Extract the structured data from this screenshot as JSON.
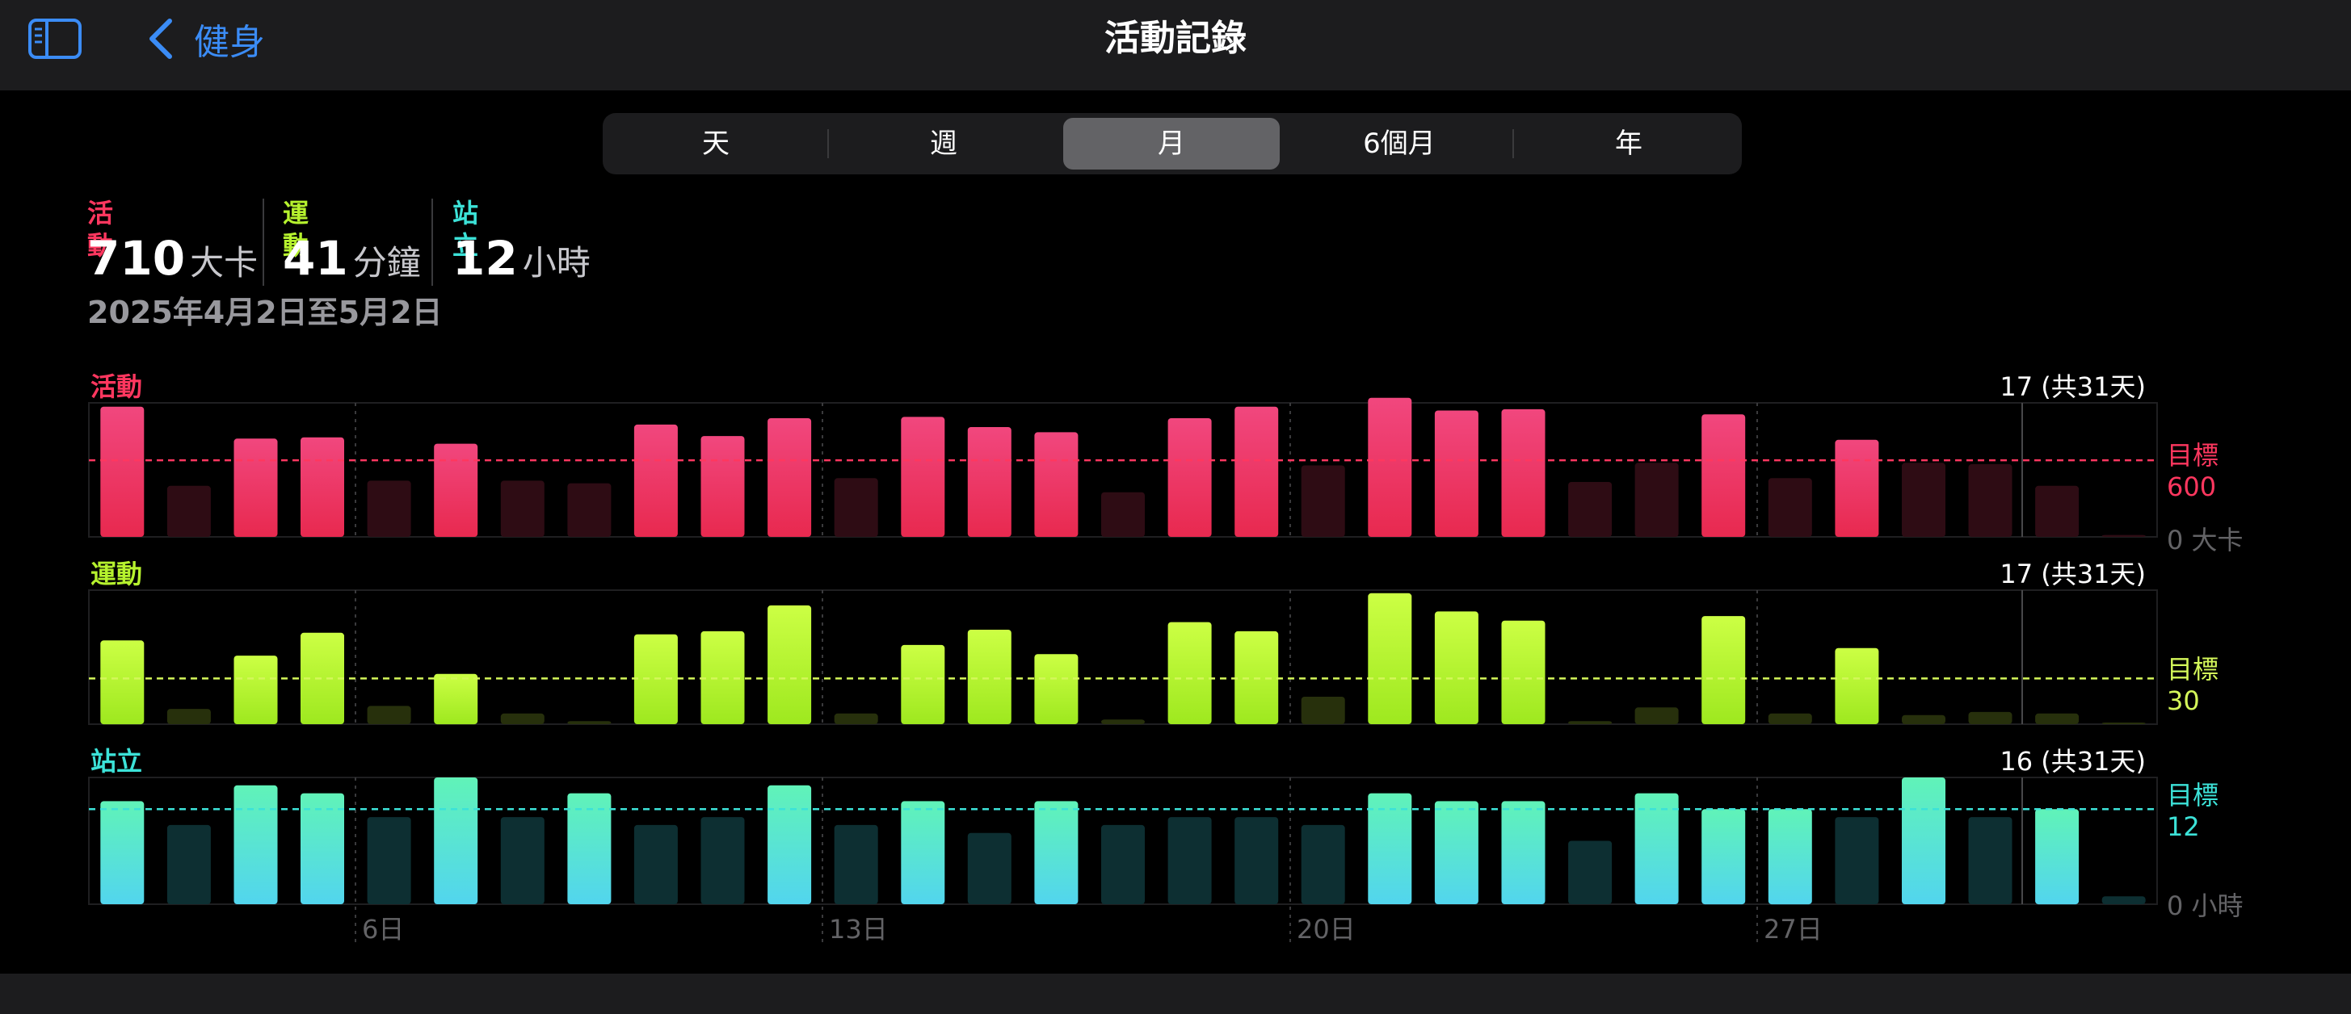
{
  "nav": {
    "back_label": "健身",
    "title": "活動記錄"
  },
  "segments": {
    "items": [
      "天",
      "週",
      "月",
      "6個月",
      "年"
    ],
    "selected": "月"
  },
  "summary": {
    "move": {
      "label": "活動",
      "value": "710",
      "unit": "大卡",
      "color": "#ff375f"
    },
    "exercise": {
      "label": "運動",
      "value": "41",
      "unit": "分鐘",
      "color": "#b6f22e"
    },
    "stand": {
      "label": "站立",
      "value": "12",
      "unit": "小時",
      "color": "#3ce2d8"
    },
    "date_range": "2025年4月2日至5月2日"
  },
  "chart_data": [
    {
      "type": "bar",
      "title": "活動",
      "count_label": "17 (共31天)",
      "goal_label": "目標",
      "goal_value": 600,
      "goal_value_label": "600",
      "zero_label": "0 大卡",
      "ylim": [
        0,
        1050
      ],
      "color_top": "#f1477e",
      "color_bottom": "#e8294f",
      "dim_color": "#2e0c14",
      "x_tick_labels": [
        "6日",
        "13日",
        "20日",
        "27日"
      ],
      "values": [
        1020,
        400,
        770,
        780,
        440,
        730,
        440,
        420,
        880,
        790,
        930,
        460,
        940,
        860,
        820,
        350,
        930,
        1020,
        560,
        1090,
        990,
        1000,
        430,
        580,
        960,
        460,
        760,
        580,
        570,
        400,
        15
      ]
    },
    {
      "type": "bar",
      "title": "運動",
      "count_label": "17 (共31天)",
      "goal_label": "目標",
      "goal_value": 30,
      "goal_value_label": "30",
      "ylim": [
        0,
        88
      ],
      "color_top": "#ccff44",
      "color_bottom": "#9ee81f",
      "dim_color": "#27300c",
      "x_tick_labels": [
        "6日",
        "13日",
        "20日",
        "27日"
      ],
      "values": [
        55,
        10,
        45,
        60,
        12,
        33,
        7,
        2,
        59,
        61,
        78,
        7,
        52,
        62,
        46,
        3,
        67,
        61,
        18,
        86,
        74,
        68,
        2,
        11,
        71,
        7,
        50,
        6,
        8,
        7,
        0
      ]
    },
    {
      "type": "bar",
      "title": "站立",
      "count_label": "16 (共31天)",
      "goal_label": "目標",
      "goal_value": 12,
      "goal_value_label": "12",
      "zero_label": "0 小時",
      "ylim": [
        0,
        16
      ],
      "color_top": "#60f3b8",
      "color_bottom": "#52d5ee",
      "dim_color": "#0d2f32",
      "x_tick_labels": [
        "6日",
        "13日",
        "20日",
        "27日"
      ],
      "values": [
        13,
        10,
        15,
        14,
        11,
        16,
        11,
        14,
        10,
        11,
        15,
        10,
        13,
        9,
        13,
        10,
        11,
        11,
        10,
        14,
        13,
        13,
        8,
        14,
        12,
        12,
        11,
        16,
        11,
        12,
        1
      ]
    }
  ]
}
